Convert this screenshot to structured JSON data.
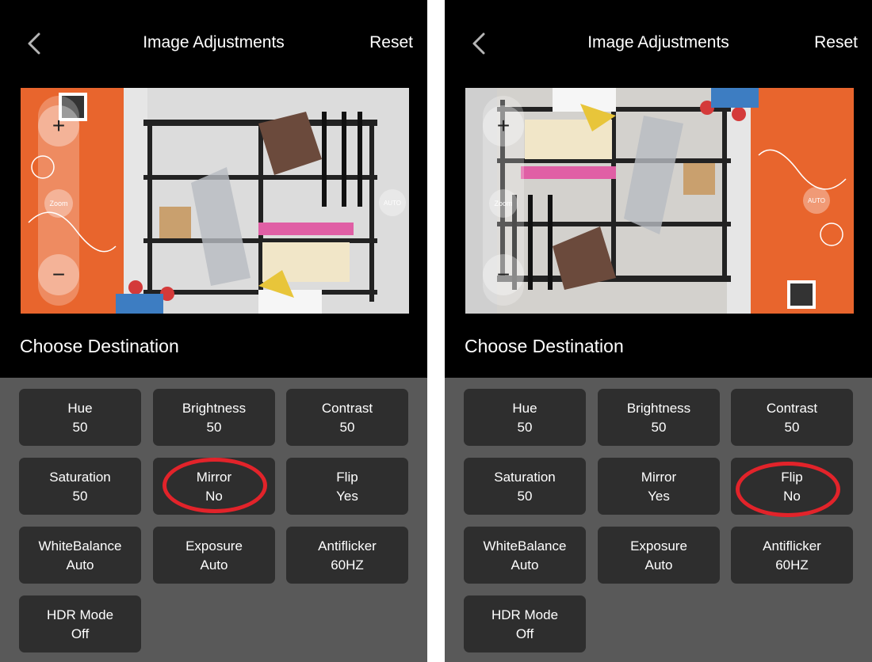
{
  "screens": [
    {
      "header": {
        "title": "Image Adjustments",
        "reset_label": "Reset"
      },
      "preview": {
        "zoom_label": "Zoom",
        "auto_label": "AUTO"
      },
      "section_title": "Choose Destination",
      "tiles": [
        {
          "label": "Hue",
          "value": "50"
        },
        {
          "label": "Brightness",
          "value": "50"
        },
        {
          "label": "Contrast",
          "value": "50"
        },
        {
          "label": "Saturation",
          "value": "50"
        },
        {
          "label": "Mirror",
          "value": "No"
        },
        {
          "label": "Flip",
          "value": "Yes"
        },
        {
          "label": "WhiteBalance",
          "value": "Auto"
        },
        {
          "label": "Exposure",
          "value": "Auto"
        },
        {
          "label": "Antiflicker",
          "value": "60HZ"
        },
        {
          "label": "HDR Mode",
          "value": "Off"
        }
      ],
      "highlighted_tile": "Mirror"
    },
    {
      "header": {
        "title": "Image Adjustments",
        "reset_label": "Reset"
      },
      "preview": {
        "zoom_label": "Zoom",
        "auto_label": "AUTO"
      },
      "section_title": "Choose Destination",
      "tiles": [
        {
          "label": "Hue",
          "value": "50"
        },
        {
          "label": "Brightness",
          "value": "50"
        },
        {
          "label": "Contrast",
          "value": "50"
        },
        {
          "label": "Saturation",
          "value": "50"
        },
        {
          "label": "Mirror",
          "value": "Yes"
        },
        {
          "label": "Flip",
          "value": "No"
        },
        {
          "label": "WhiteBalance",
          "value": "Auto"
        },
        {
          "label": "Exposure",
          "value": "Auto"
        },
        {
          "label": "Antiflicker",
          "value": "60HZ"
        },
        {
          "label": "HDR Mode",
          "value": "Off"
        }
      ],
      "highlighted_tile": "Flip"
    }
  ],
  "colors": {
    "accent_orange": "#e8652d",
    "highlight_red": "#e2232a",
    "panel_bg": "#595959",
    "tile_bg": "#2e2e2e"
  }
}
